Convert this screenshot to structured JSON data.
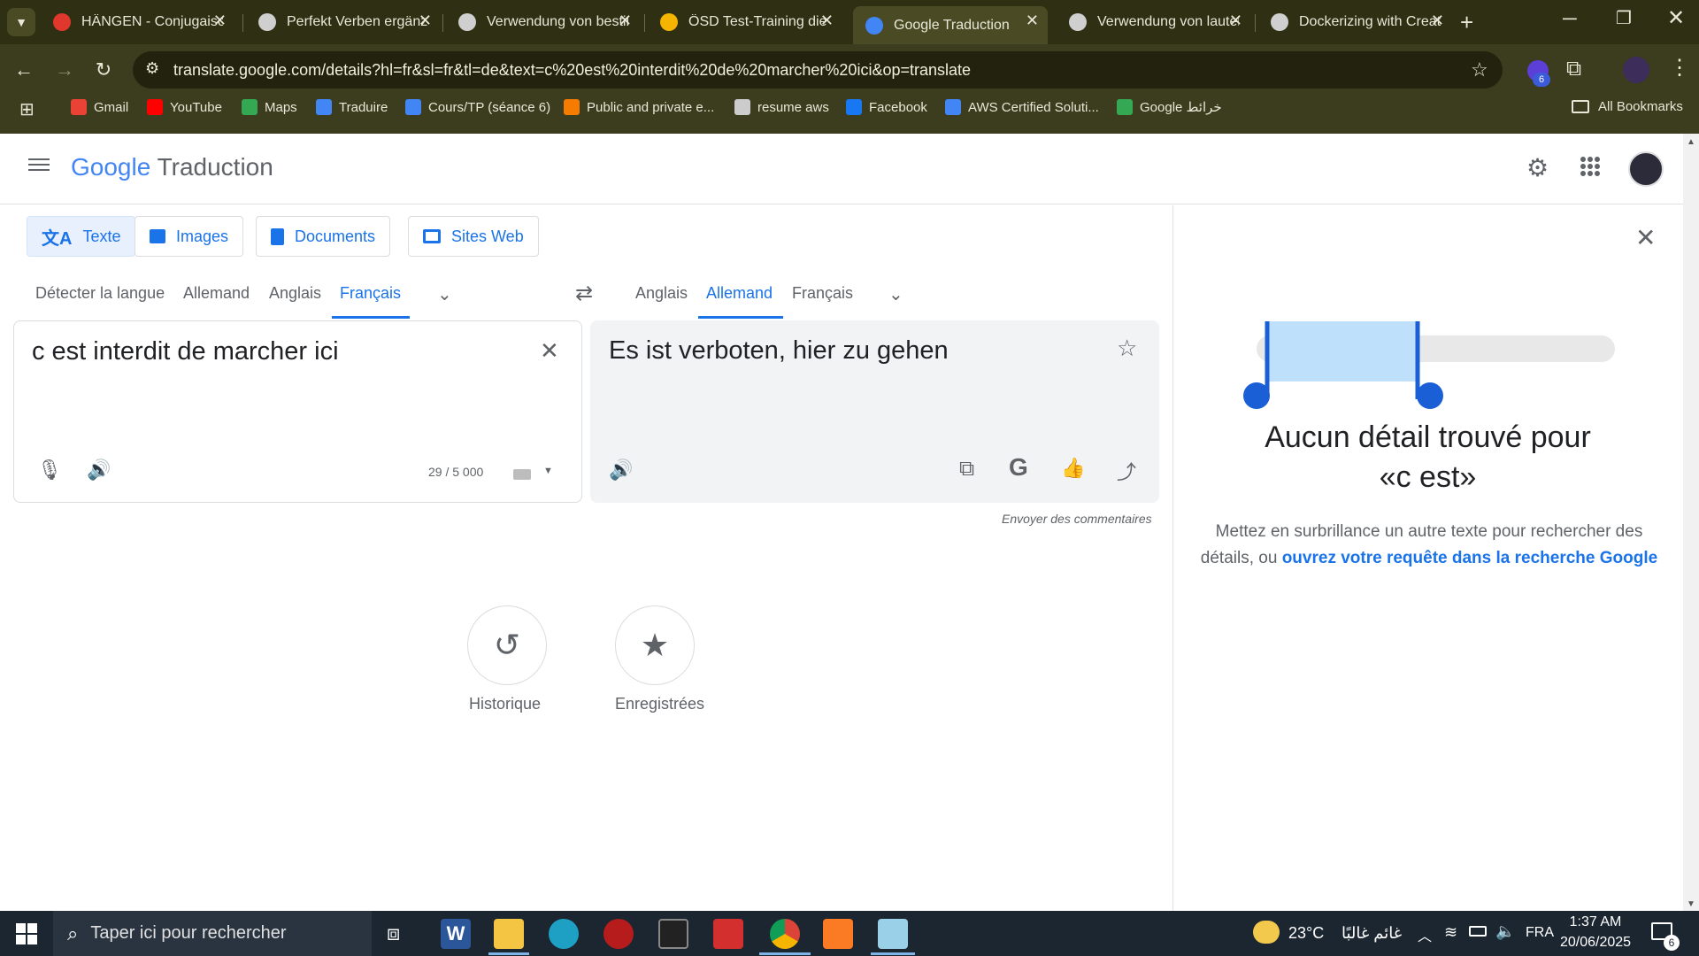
{
  "browser": {
    "tabs": [
      {
        "title": "HÄNGEN - Conjugaison",
        "favicon": "red-g-icon",
        "color": "#e0382c"
      },
      {
        "title": "Perfekt Verben ergänzen",
        "favicon": "openai-icon",
        "color": "#cfcfcf"
      },
      {
        "title": "Verwendung von bestimmt",
        "favicon": "openai-icon",
        "color": "#cfcfcf"
      },
      {
        "title": "ÖSD Test-Training die",
        "favicon": "osd-icon",
        "color": "#f4b400"
      },
      {
        "title": "Google Traduction",
        "favicon": "google-translate-icon",
        "color": "#4285f4",
        "active": true
      },
      {
        "title": "Verwendung von lauter",
        "favicon": "openai-icon",
        "color": "#cfcfcf"
      },
      {
        "title": "Dockerizing with Create",
        "favicon": "openai-icon",
        "color": "#cfcfcf"
      }
    ],
    "url": "translate.google.com/details?hl=fr&sl=fr&tl=de&text=c%20est%20interdit%20de%20marcher%20ici&op=translate",
    "extensions_badge": "6",
    "bookmarks": [
      {
        "label": "Gmail",
        "color": "#ea4335"
      },
      {
        "label": "YouTube",
        "color": "#ff0000"
      },
      {
        "label": "Maps",
        "color": "#34a853"
      },
      {
        "label": "Traduire",
        "color": "#4285f4"
      },
      {
        "label": "Cours/TP (séance 6)",
        "color": "#4285f4"
      },
      {
        "label": "Public and private e...",
        "color": "#f57c00"
      },
      {
        "label": "resume aws",
        "color": "#cccccc"
      },
      {
        "label": "Facebook",
        "color": "#1877f2"
      },
      {
        "label": "AWS Certified Soluti...",
        "color": "#4285f4"
      },
      {
        "label": "Google خرائط",
        "color": "#34a853"
      }
    ],
    "all_bookmarks": "All Bookmarks"
  },
  "app": {
    "logo_google": "Google",
    "logo_product": "Traduction",
    "modes": [
      "Texte",
      "Images",
      "Documents",
      "Sites Web"
    ],
    "source_langs": [
      "Détecter la langue",
      "Allemand",
      "Anglais",
      "Français"
    ],
    "target_langs": [
      "Anglais",
      "Allemand",
      "Français"
    ],
    "source_text": "c est interdit de marcher ici",
    "char_count": "29 / 5 000",
    "translated_text": "Es ist verboten, hier zu gehen",
    "feedback": "Envoyer des commentaires",
    "history_label": "Historique",
    "saved_label": "Enregistrées"
  },
  "details": {
    "title_line1": "Aucun détail trouvé pour",
    "title_line2": "«c est»",
    "body": "Mettez en surbrillance un autre texte pour rechercher des détails, ou ",
    "link": "ouvrez votre requête dans la recherche Google"
  },
  "taskbar": {
    "search_placeholder": "Taper ici pour rechercher",
    "weather_temp": "23°C",
    "weather_text": "غائم غالبًا",
    "lang": "FRA",
    "time": "1:37 AM",
    "date": "20/06/2025",
    "notif_count": "6"
  },
  "colors": {
    "accent": "#1a73e8",
    "chrome_bg": "#3c3c1e"
  }
}
